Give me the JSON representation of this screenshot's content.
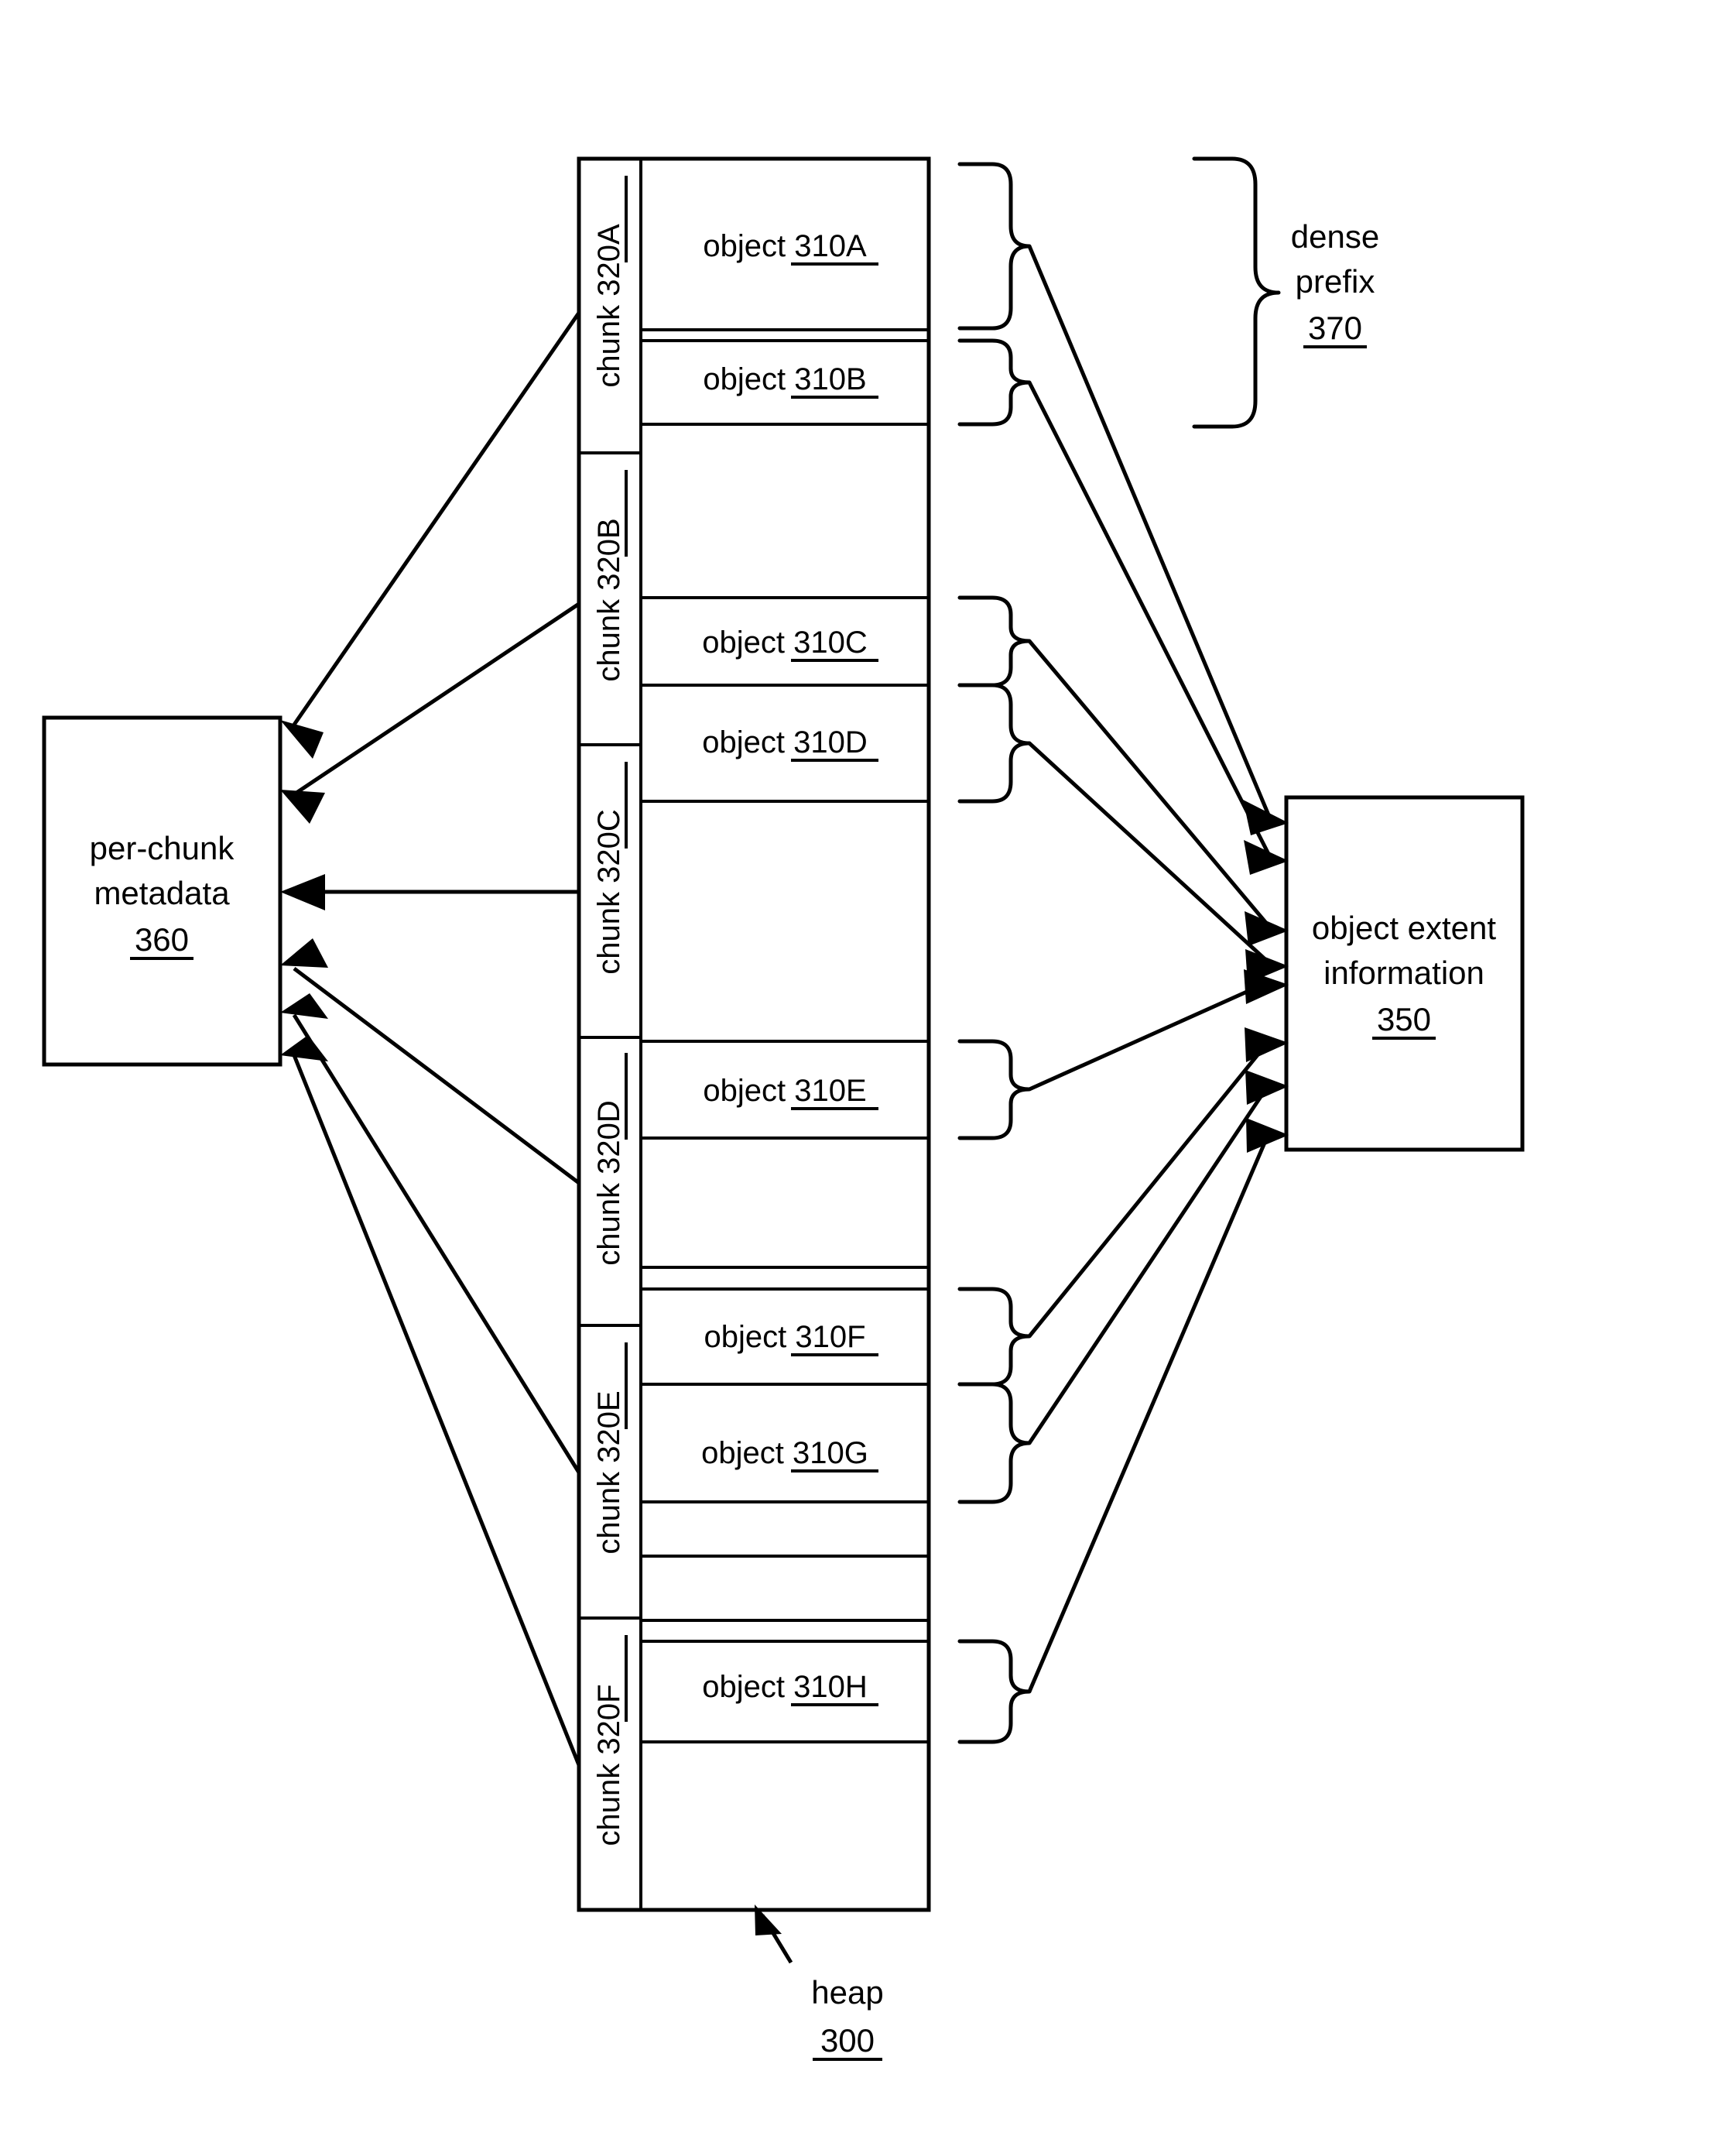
{
  "figure": {
    "title": "heap chunk and object extent diagram",
    "ink_color": "#000000",
    "background_color": "#ffffff"
  },
  "heap": {
    "label_word": "heap",
    "label_ref": "300"
  },
  "left_box": {
    "line1": "per-chunk",
    "line2": "metadata",
    "ref": "360"
  },
  "right_box": {
    "line1": "object extent",
    "line2": "information",
    "ref": "350"
  },
  "dense_prefix": {
    "line1": "dense",
    "line2": "prefix",
    "ref": "370"
  },
  "chunks": [
    {
      "word": "chunk",
      "ref": "320A"
    },
    {
      "word": "chunk",
      "ref": "320B"
    },
    {
      "word": "chunk",
      "ref": "320C"
    },
    {
      "word": "chunk",
      "ref": "320D"
    },
    {
      "word": "chunk",
      "ref": "320E"
    },
    {
      "word": "chunk",
      "ref": "320F"
    }
  ],
  "objects": [
    {
      "word": "object",
      "ref": "310A"
    },
    {
      "word": "object",
      "ref": "310B"
    },
    {
      "word": "object",
      "ref": "310C"
    },
    {
      "word": "object",
      "ref": "310D"
    },
    {
      "word": "object",
      "ref": "310E"
    },
    {
      "word": "object",
      "ref": "310F"
    },
    {
      "word": "object",
      "ref": "310G"
    },
    {
      "word": "object",
      "ref": "310H"
    }
  ]
}
